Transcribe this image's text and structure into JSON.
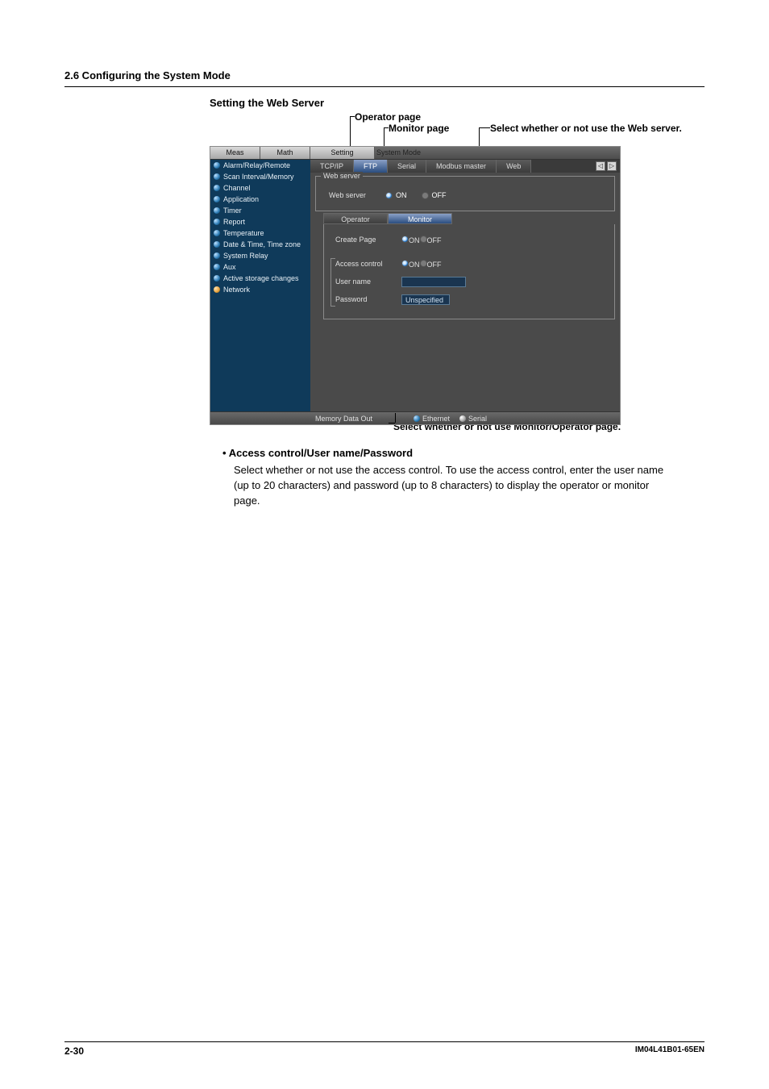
{
  "section_header": "2.6  Configuring the System Mode",
  "figure_title": "Setting the Web Server",
  "annot_operator": "Operator page",
  "annot_monitor": "Monitor page",
  "annot_select1": "Select whether or not use the Web server.",
  "annot_select2": "Select whether or not use Monitor/Operator page.",
  "topbar": {
    "meas": "Meas",
    "math": "Math",
    "setting": "Setting",
    "mode": "System Mode"
  },
  "sidebar": [
    "Alarm/Relay/Remote",
    "Scan Interval/Memory",
    "Channel",
    "Application",
    "Timer",
    "Report",
    "Temperature",
    "Date & Time, Time zone",
    "System Relay",
    "Aux",
    "Active storage changes",
    "Network"
  ],
  "tabs": [
    "TCP/IP",
    "FTP",
    "Serial",
    "Modbus master",
    "Web"
  ],
  "group1_label": "Web server",
  "row1_label": "Web server",
  "on": "ON",
  "off": "OFF",
  "subtabs": [
    "Operator",
    "Monitor"
  ],
  "row_create": "Create Page",
  "row_access": "Access control",
  "row_user": "User name",
  "row_pass": "Password",
  "pass_value": "Unspecified",
  "footer_memory": "Memory Data Out",
  "footer_eth": "Ethernet",
  "footer_serial": "Serial",
  "bullet_head": "Access control/User name/Password",
  "bullet_body": "Select whether or not use the access control. To use the access control, enter the user name (up to 20 characters) and password (up to 8 characters) to display the operator or monitor page.",
  "page_number": "2-30",
  "doc_id": "IM04L41B01-65EN"
}
